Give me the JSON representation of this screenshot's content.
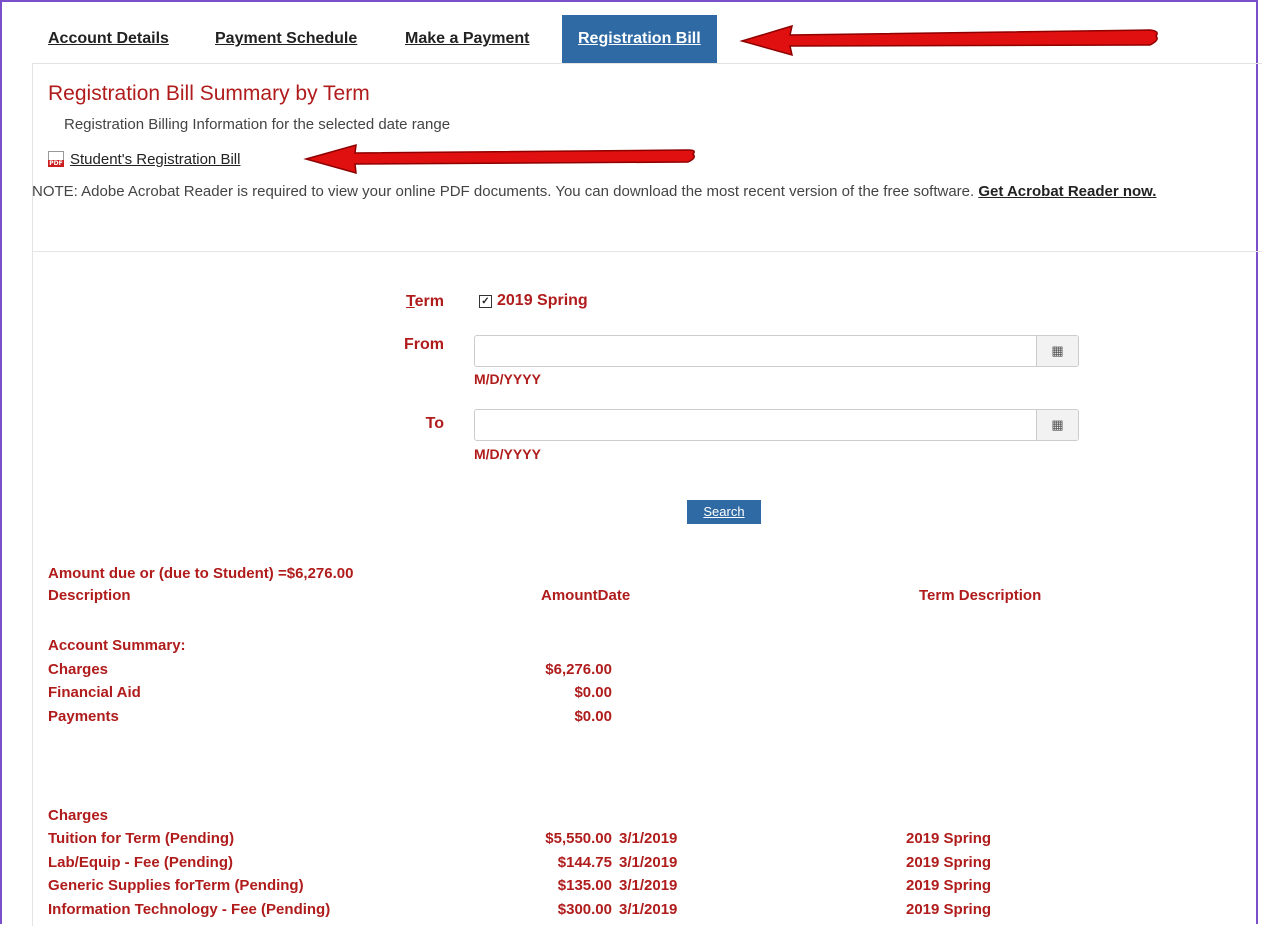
{
  "tabs": [
    {
      "label": "Account Details"
    },
    {
      "label": "Payment Schedule"
    },
    {
      "label": "Make a Payment"
    },
    {
      "label": "Registration Bill",
      "active": true
    }
  ],
  "section": {
    "title": "Registration Bill Summary by Term",
    "subtitle": "Registration Billing Information for the selected date range",
    "pdf_link": "Student's Registration Bill",
    "note_text": "NOTE: Adobe Acrobat Reader is required to view your online PDF documents. You can download the most recent version of the free software. ",
    "note_link": "Get Acrobat Reader now."
  },
  "filter": {
    "term_label_initial": "T",
    "term_label_rest": "erm",
    "term_value": "2019 Spring",
    "term_checked": true,
    "from_label": "From",
    "to_label": "To",
    "date_hint": "M/D/YYYY",
    "from_value": "",
    "to_value": "",
    "search_label": "Search"
  },
  "summary": {
    "amount_due_line": "Amount due or (due to Student) =$6,276.00",
    "headers": {
      "description": "Description",
      "amount_date": "AmountDate",
      "term_description": "Term Description"
    },
    "account_summary_label": "Account Summary:",
    "account_summary": [
      {
        "description": "Charges",
        "amount": "$6,276.00"
      },
      {
        "description": "Financial Aid",
        "amount": "$0.00"
      },
      {
        "description": "Payments",
        "amount": "$0.00"
      }
    ],
    "charges_label": "Charges",
    "charges": [
      {
        "description": "Tuition for Term (Pending)",
        "amount": "$5,550.00",
        "date": "3/1/2019",
        "term": "2019 Spring"
      },
      {
        "description": "Lab/Equip - Fee (Pending)",
        "amount": "$144.75",
        "date": "3/1/2019",
        "term": "2019 Spring"
      },
      {
        "description": "Generic Supplies forTerm (Pending)",
        "amount": "$135.00",
        "date": "3/1/2019",
        "term": "2019 Spring"
      },
      {
        "description": "Information Technology - Fee (Pending)",
        "amount": "$300.00",
        "date": "3/1/2019",
        "term": "2019 Spring"
      }
    ]
  },
  "colors": {
    "accent": "#2f6aa4",
    "label_red": "#b01c1c",
    "annotation_arrow": "#e01010",
    "frame": "#7a4fc9"
  }
}
